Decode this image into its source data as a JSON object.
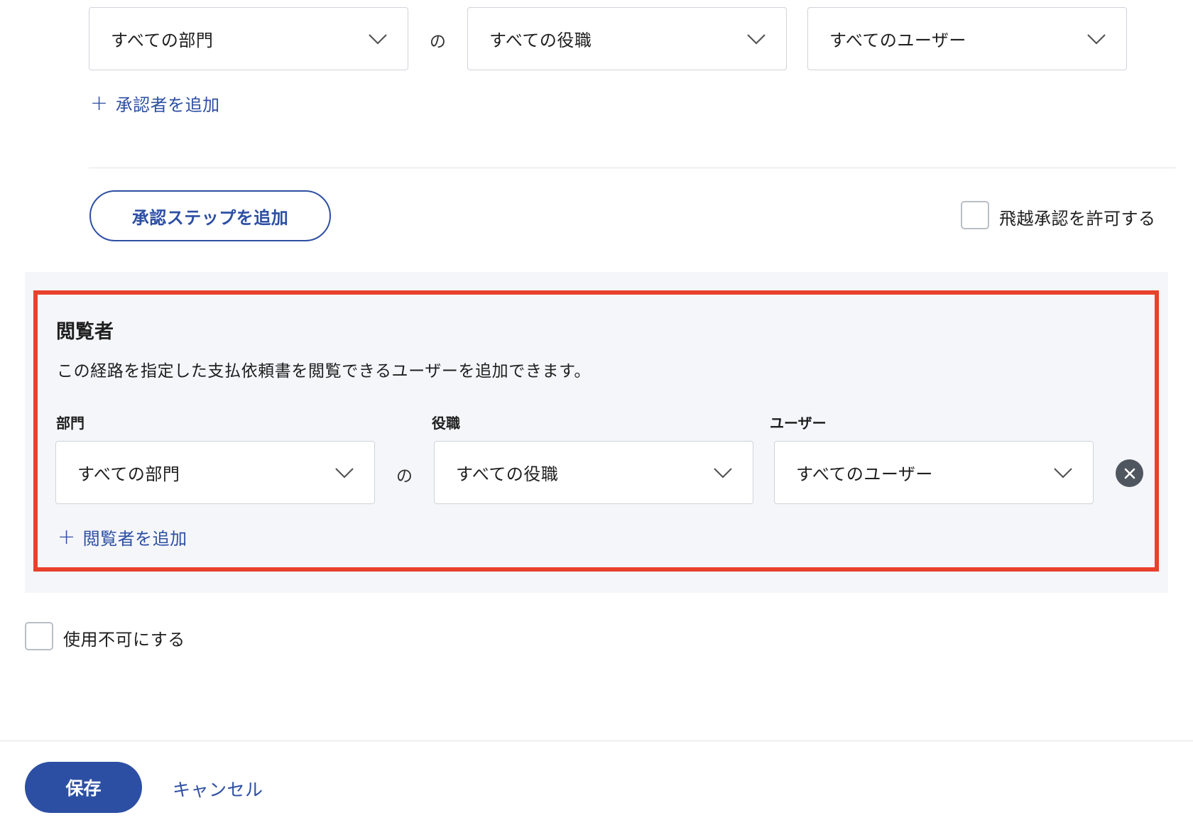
{
  "approver_row": {
    "department": "すべての部門",
    "connector": "の",
    "position": "すべての役職",
    "user": "すべてのユーザー"
  },
  "add_approver_link": "承認者を追加",
  "add_step_button": "承認ステップを追加",
  "skip_approval_label": "飛越承認を許可する",
  "viewers": {
    "title": "閲覧者",
    "description": "この経路を指定した支払依頼書を閲覧できるユーザーを追加できます。",
    "labels": {
      "department": "部門",
      "position": "役職",
      "user": "ユーザー"
    },
    "row": {
      "department": "すべての部門",
      "connector": "の",
      "position": "すべての役職",
      "user": "すべてのユーザー"
    },
    "add_link": "閲覧者を追加"
  },
  "disable_label": "使用不可にする",
  "footer": {
    "save": "保存",
    "cancel": "キャンセル"
  },
  "colors": {
    "accent": "#2d4fa3",
    "highlight": "#e8412c",
    "panel_bg": "#f5f6fa"
  },
  "icons": {
    "dropdown": "chevron-down-icon",
    "add": "plus-icon",
    "remove": "close-circle-icon"
  }
}
